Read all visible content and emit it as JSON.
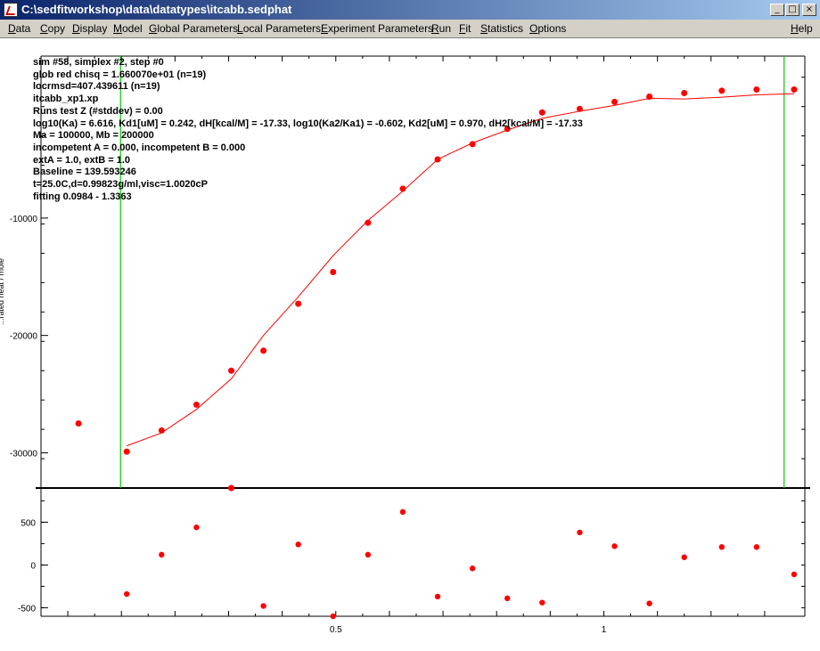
{
  "window": {
    "title": "C:\\sedfitworkshop\\data\\datatypes\\itcabb.sedphat"
  },
  "titlebar_buttons": [
    "_",
    "□",
    "×"
  ],
  "menu": [
    {
      "label": "Data",
      "underline": "D",
      "rest": "ata"
    },
    {
      "label": "Copy",
      "underline": "C",
      "rest": "opy"
    },
    {
      "label": "Display",
      "underline": "D",
      "rest": "isplay"
    },
    {
      "label": "Model",
      "underline": "M",
      "rest": "odel"
    },
    {
      "label": "Global Parameters",
      "underline": "G",
      "rest": "lobal Parameters"
    },
    {
      "label": "Local Parameters",
      "underline": "L",
      "rest": "ocal Parameters"
    },
    {
      "label": "Experiment Parameters",
      "underline": "E",
      "rest": "xperiment Parameters"
    },
    {
      "label": "Run",
      "underline": "R",
      "rest": "un"
    },
    {
      "label": "Fit",
      "underline": "F",
      "rest": "it"
    },
    {
      "label": "Statistics",
      "underline": "S",
      "rest": "tatistics"
    },
    {
      "label": "Options",
      "underline": "O",
      "rest": "ptions"
    },
    {
      "label": "Help",
      "underline": "H",
      "rest": "elp"
    }
  ],
  "info": [
    "sim #58, simplex #2, step #0",
    "glob red chisq = 1.660070e+01 (n=19)",
    "locrmsd=407.439611 (n=19)",
    "itcabb_xp1.xp",
    "Runs test Z (#stddev) = 0.00",
    "log10(Ka) = 6.616, Kd1[uM] = 0.242, dH[kcal/M] = -17.33, log10(Ka2/Ka1) = -0.602, Kd2[uM] = 0.970, dH2[kcal/M] = -17.33",
    "Ma = 100000, Mb = 200000",
    "incompetent A = 0.000, incompetent B = 0.000",
    "extA = 1.0, extB = 1.0",
    "Baseline = 139.593246",
    "t=25.0C,d=0.99823g/ml,visc=1.0020cP",
    "fitting 0.0984 - 1.3363"
  ],
  "chart_data": [
    {
      "type": "scatter",
      "name": "isotherm",
      "y_tick_labels": [
        "-10000",
        "-20000",
        "-30000"
      ],
      "ylabel_partial": "...rated heat / mole",
      "ylim": [
        -33000,
        3800
      ],
      "xlim": [
        -0.05,
        1.375
      ],
      "fitting_limits": [
        0.0984,
        1.3363
      ],
      "points": [
        [
          0.02,
          -27500
        ],
        [
          0.11,
          -29900
        ],
        [
          0.175,
          -28100
        ],
        [
          0.24,
          -25900
        ],
        [
          0.305,
          -23000
        ],
        [
          0.365,
          -21300
        ],
        [
          0.43,
          -17300
        ],
        [
          0.495,
          -14600
        ],
        [
          0.56,
          -10400
        ],
        [
          0.625,
          -7500
        ],
        [
          0.69,
          -5000
        ],
        [
          0.755,
          -3700
        ],
        [
          0.82,
          -2400
        ],
        [
          0.885,
          -1000
        ],
        [
          0.955,
          -700
        ],
        [
          1.02,
          -100
        ],
        [
          1.085,
          350
        ],
        [
          1.15,
          650
        ],
        [
          1.22,
          850
        ],
        [
          1.285,
          950
        ],
        [
          1.355,
          950
        ]
      ],
      "off_scale_low_x": 0.305,
      "fit_curve": [
        [
          0.11,
          -29400
        ],
        [
          0.175,
          -28300
        ],
        [
          0.24,
          -26300
        ],
        [
          0.305,
          -23700
        ],
        [
          0.365,
          -20000
        ],
        [
          0.43,
          -16700
        ],
        [
          0.495,
          -13200
        ],
        [
          0.56,
          -10200
        ],
        [
          0.625,
          -7700
        ],
        [
          0.69,
          -5000
        ],
        [
          0.755,
          -3600
        ],
        [
          0.82,
          -2500
        ],
        [
          0.885,
          -1500
        ],
        [
          0.955,
          -900
        ],
        [
          1.02,
          -400
        ],
        [
          1.085,
          200
        ],
        [
          1.15,
          150
        ],
        [
          1.22,
          300
        ],
        [
          1.285,
          500
        ],
        [
          1.355,
          600
        ]
      ],
      "annotations": [],
      "grid": false
    },
    {
      "type": "scatter",
      "name": "residuals",
      "y_tick_labels": [
        "500",
        "0",
        "-500"
      ],
      "x_tick_labels": [
        "0.5",
        "1"
      ],
      "ylim": [
        -600,
        900
      ],
      "xlim": [
        -0.05,
        1.375
      ],
      "points": [
        [
          0.11,
          -340
        ],
        [
          0.175,
          120
        ],
        [
          0.24,
          440
        ],
        [
          0.305,
          1000
        ],
        [
          0.365,
          -480
        ],
        [
          0.43,
          240
        ],
        [
          0.495,
          -600
        ],
        [
          0.56,
          120
        ],
        [
          0.625,
          620
        ],
        [
          0.69,
          -370
        ],
        [
          0.755,
          -40
        ],
        [
          0.82,
          -390
        ],
        [
          0.885,
          -440
        ],
        [
          0.955,
          380
        ],
        [
          1.02,
          220
        ],
        [
          1.085,
          -450
        ],
        [
          1.15,
          90
        ],
        [
          1.22,
          210
        ],
        [
          1.285,
          210
        ],
        [
          1.355,
          -110
        ]
      ]
    }
  ],
  "colors": {
    "points": "#ff0000",
    "fit": "#ff0000",
    "limits": "#00cc00",
    "axis": "#000000"
  }
}
